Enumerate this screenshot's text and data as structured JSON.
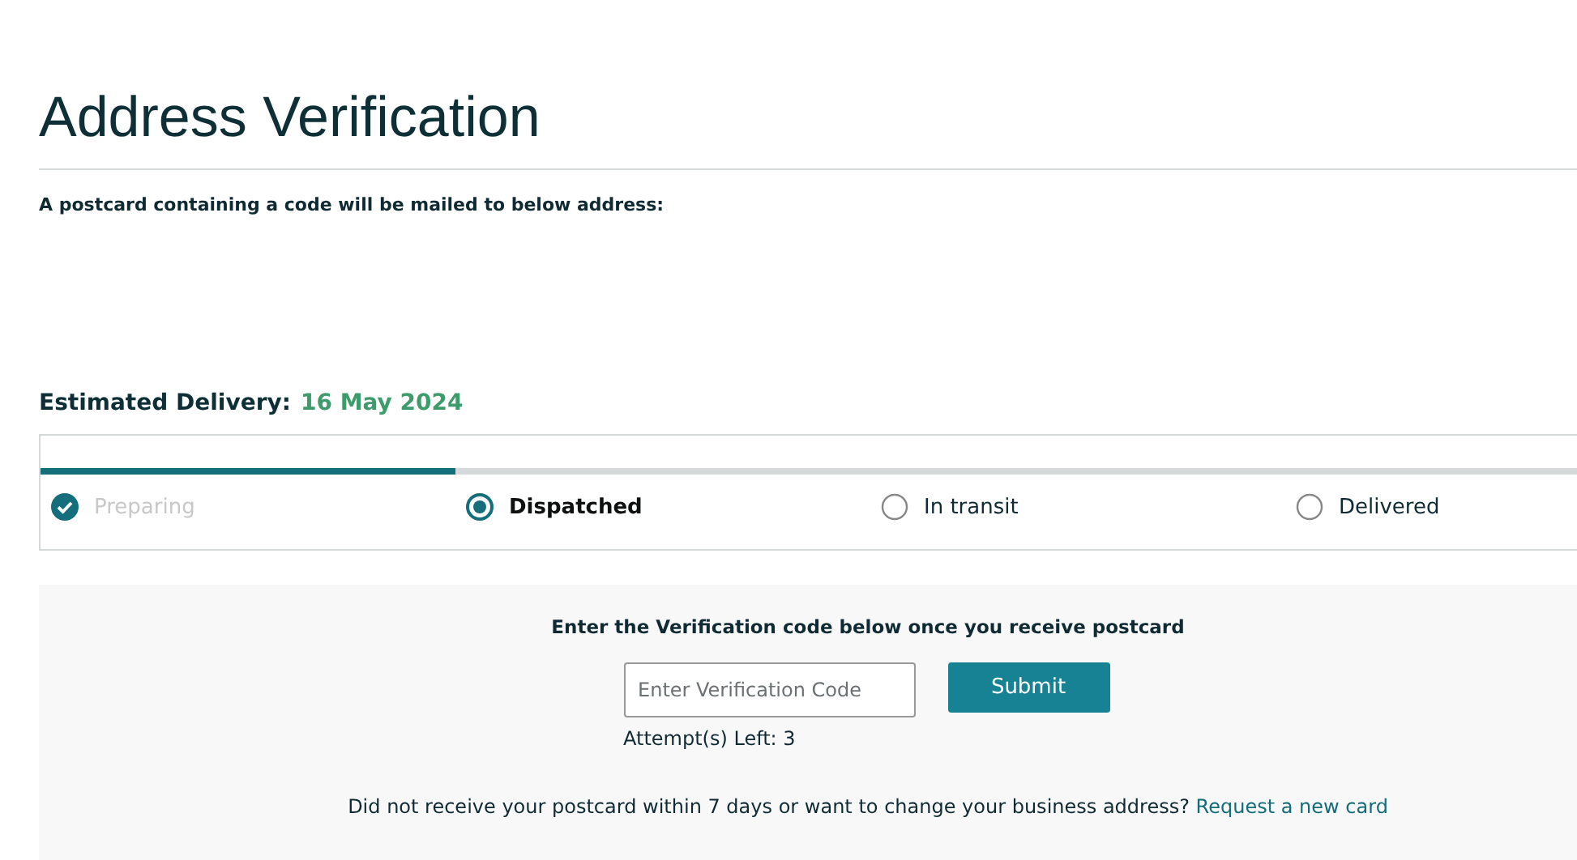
{
  "title": "Address Verification",
  "notice": "A postcard containing a code will be mailed to below address:",
  "delivery": {
    "label": "Estimated Delivery:",
    "date": "16 May 2024"
  },
  "tracker": {
    "level": 0.25,
    "steps": [
      {
        "label": "Preparing",
        "kind": "done"
      },
      {
        "label": "Dispatched",
        "kind": "current"
      },
      {
        "label": "In transit",
        "kind": "pending"
      },
      {
        "label": "Delivered",
        "kind": "pending"
      }
    ]
  },
  "verify": {
    "heading": "Enter the Verification code below once you receive postcard",
    "placeholder": "Enter Verification Code",
    "button": "Submit",
    "attempts": "Attempt(s) Left: 3",
    "help": "Did not receive your postcard within 7 days or want to change your business address?",
    "link": "Request a new card"
  }
}
